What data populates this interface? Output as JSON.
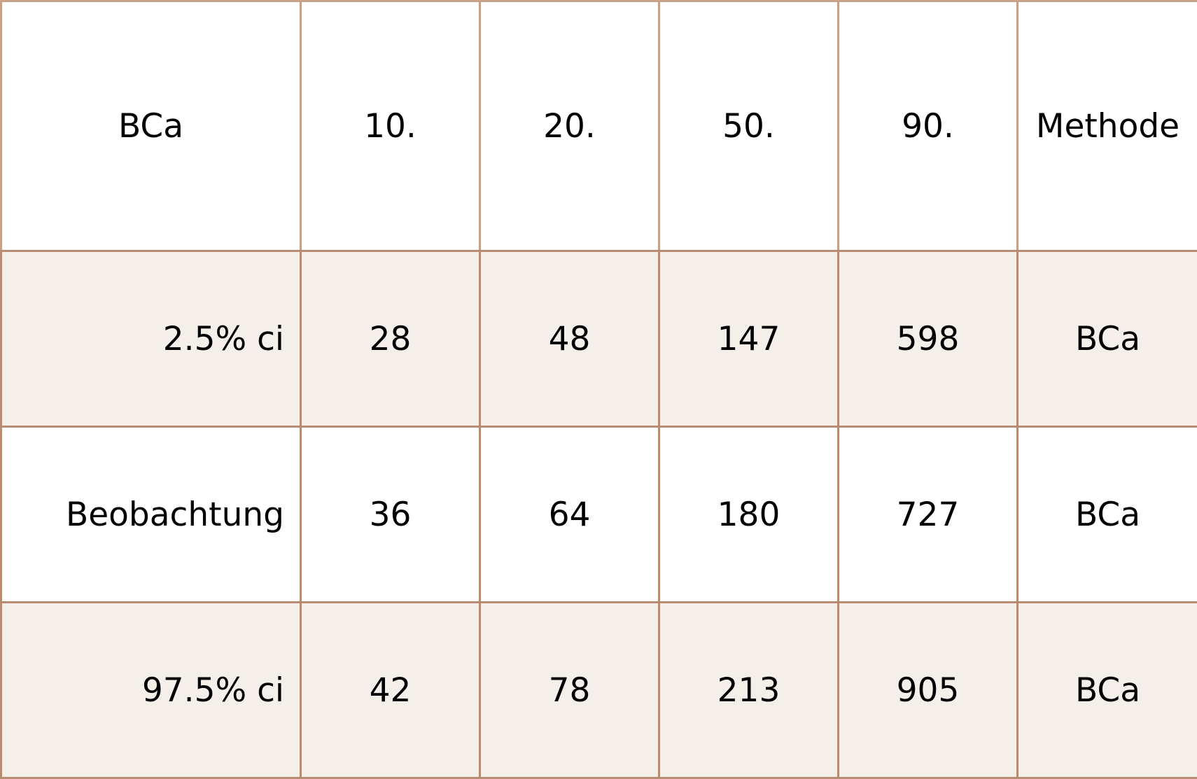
{
  "table": {
    "corner_label": "BCa",
    "columns": [
      "10.",
      "20.",
      "50.",
      "90.",
      "Methode"
    ],
    "rows": [
      {
        "label": "2.5% ci",
        "values": [
          "28",
          "48",
          "147",
          "598",
          "BCa"
        ]
      },
      {
        "label": "Beobachtung",
        "values": [
          "36",
          "64",
          "180",
          "727",
          "BCa"
        ]
      },
      {
        "label": "97.5% ci",
        "values": [
          "42",
          "78",
          "213",
          "905",
          "BCa"
        ]
      }
    ]
  },
  "colors": {
    "border": "#b88c72",
    "shaded_row": "#f5efea",
    "background": "#ffffff",
    "text": "#000000"
  }
}
